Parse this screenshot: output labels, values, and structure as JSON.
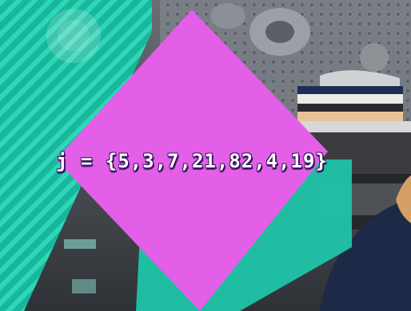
{
  "scene": {
    "equation": "j = {5,3,7,21,82,4,19}",
    "colors": {
      "magenta": "#e255e6",
      "teal": "#1fc4a8",
      "background": "#4a4d52",
      "text": "#ffffff",
      "outline": "#3a1560"
    }
  }
}
